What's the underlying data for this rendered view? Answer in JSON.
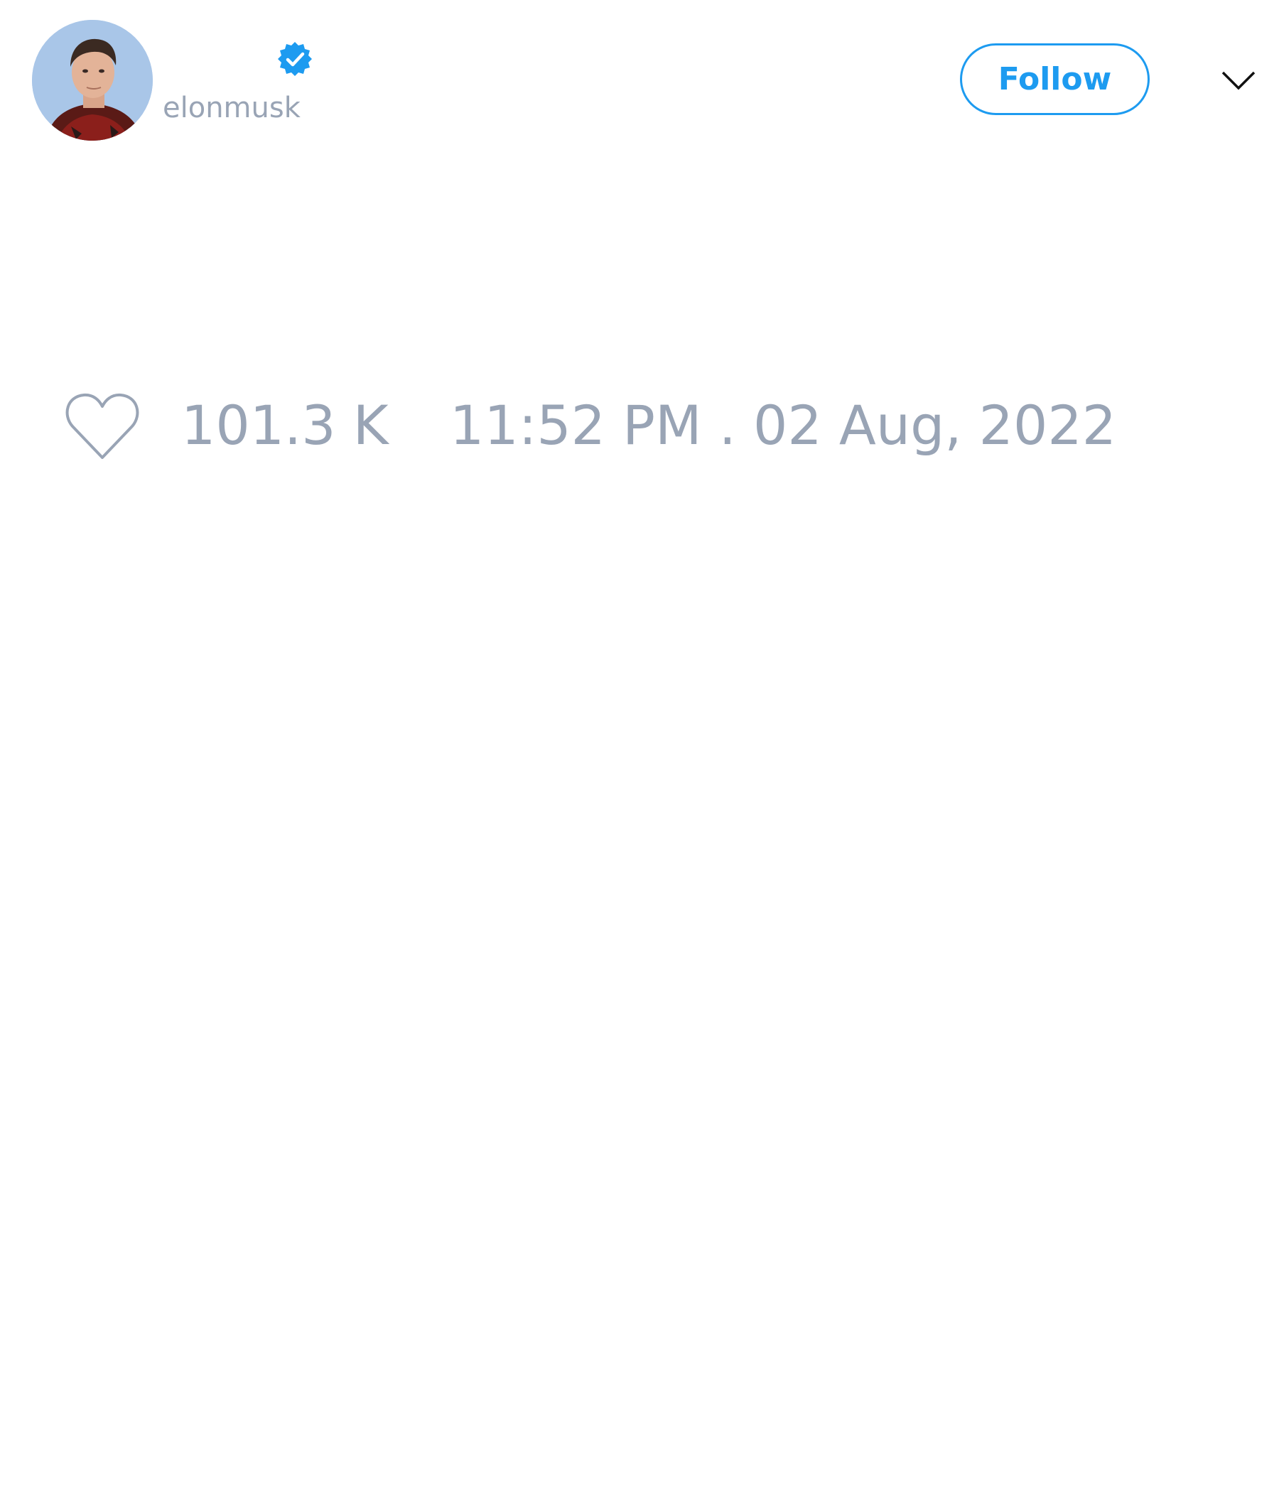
{
  "tweet": {
    "author": {
      "handle": "elonmusk",
      "verified": true,
      "avatar": "profile-photo"
    },
    "actions": {
      "follow_label": "Follow",
      "menu_icon": "chevron-down-icon"
    },
    "stats": {
      "like_icon": "heart-icon",
      "likes": "101.3 K",
      "timestamp": "11:52 PM . 02 Aug, 2022"
    }
  },
  "colors": {
    "accent": "#1d9bf0",
    "muted_text": "#99a4b5",
    "background": "#ffffff"
  }
}
